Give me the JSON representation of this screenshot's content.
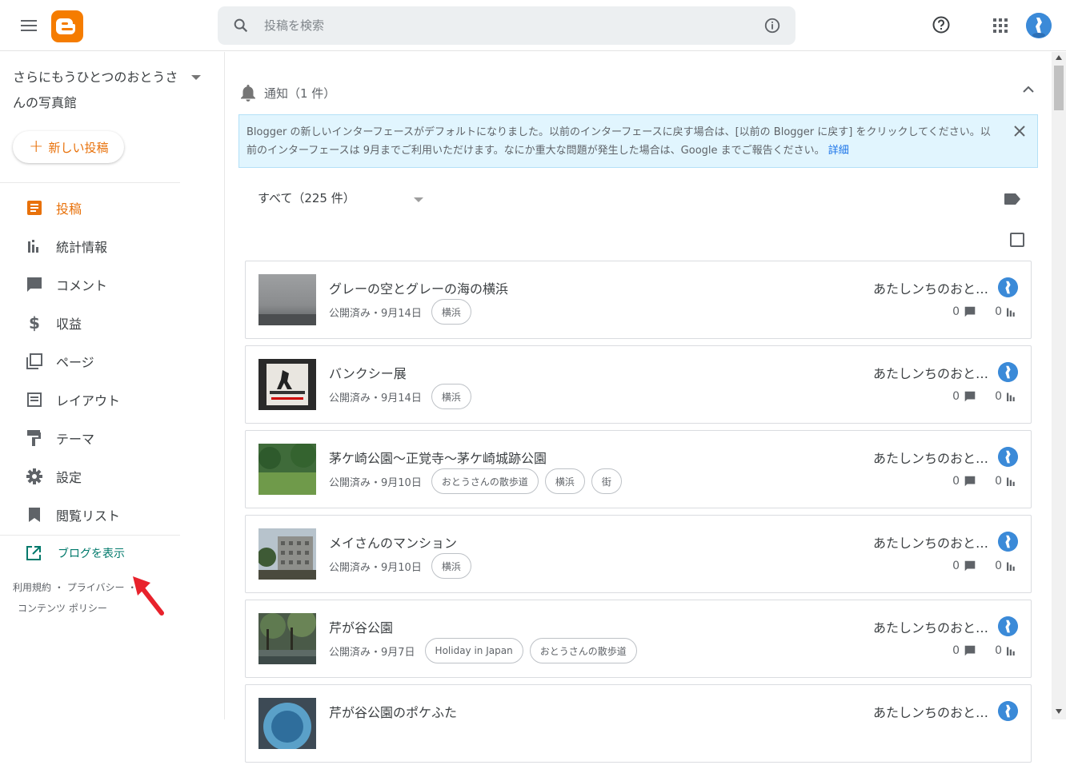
{
  "header": {
    "search_placeholder": "投稿を検索"
  },
  "sidebar": {
    "blog_title": "さらにもうひとつのおとうさんの写真館",
    "new_post_label": "新しい投稿",
    "items": [
      {
        "label": "投稿",
        "icon": "posts-icon",
        "active": true
      },
      {
        "label": "統計情報",
        "icon": "stats-icon"
      },
      {
        "label": "コメント",
        "icon": "comment-icon"
      },
      {
        "label": "収益",
        "icon": "dollar-icon"
      },
      {
        "label": "ページ",
        "icon": "pages-icon"
      },
      {
        "label": "レイアウト",
        "icon": "layout-icon"
      },
      {
        "label": "テーマ",
        "icon": "theme-icon"
      },
      {
        "label": "設定",
        "icon": "gear-icon"
      },
      {
        "label": "閲覧リスト",
        "icon": "bookmark-icon"
      }
    ],
    "view_blog_label": "ブログを表示",
    "footer": {
      "terms": "利用規約",
      "sep": "・",
      "privacy": "プライバシー",
      "sep2": "・",
      "content_policy": "コンテンツ ポリシー"
    }
  },
  "notifications": {
    "title": "通知（1 件）",
    "message": "Blogger の新しいインターフェースがデフォルトになりました。以前のインターフェースに戻す場合は、[以前の Blogger に戻す] をクリックしてください。以前のインターフェースは 9月までご利用いただけます。なにか重大な問題が発生した場合は、Google までご報告ください。",
    "more_link": "詳細"
  },
  "filter": {
    "label": "すべて（225 件）"
  },
  "posts": [
    {
      "title": "グレーの空とグレーの海の横浜",
      "meta": "公開済み・9月14日",
      "tags": [
        "横浜"
      ],
      "author": "あたしンちのおとうさん",
      "comments": "0",
      "views": "0"
    },
    {
      "title": "バンクシー展",
      "meta": "公開済み・9月14日",
      "tags": [
        "横浜"
      ],
      "author": "あたしンちのおとうさん",
      "comments": "0",
      "views": "0"
    },
    {
      "title": "茅ケ崎公園～正覚寺～茅ケ崎城跡公園",
      "meta": "公開済み・9月10日",
      "tags": [
        "おとうさんの散歩道",
        "横浜",
        "街"
      ],
      "author": "あたしンちのおとうさん",
      "comments": "0",
      "views": "0"
    },
    {
      "title": "メイさんのマンション",
      "meta": "公開済み・9月10日",
      "tags": [
        "横浜"
      ],
      "author": "あたしンちのおとうさん",
      "comments": "0",
      "views": "0"
    },
    {
      "title": "芹が谷公園",
      "meta": "公開済み・9月7日",
      "tags": [
        "Holiday in Japan",
        "おとうさんの散歩道"
      ],
      "author": "あたしンちのおとうさん",
      "comments": "0",
      "views": "0"
    },
    {
      "title": "芹が谷公園のポケふた",
      "meta": "",
      "tags": [],
      "author": "あたしンちのおとうさん",
      "comments": "",
      "views": ""
    }
  ],
  "colors": {
    "accent": "#e8710a",
    "link_teal": "#00796b",
    "banner_bg": "#e1f5fe"
  }
}
